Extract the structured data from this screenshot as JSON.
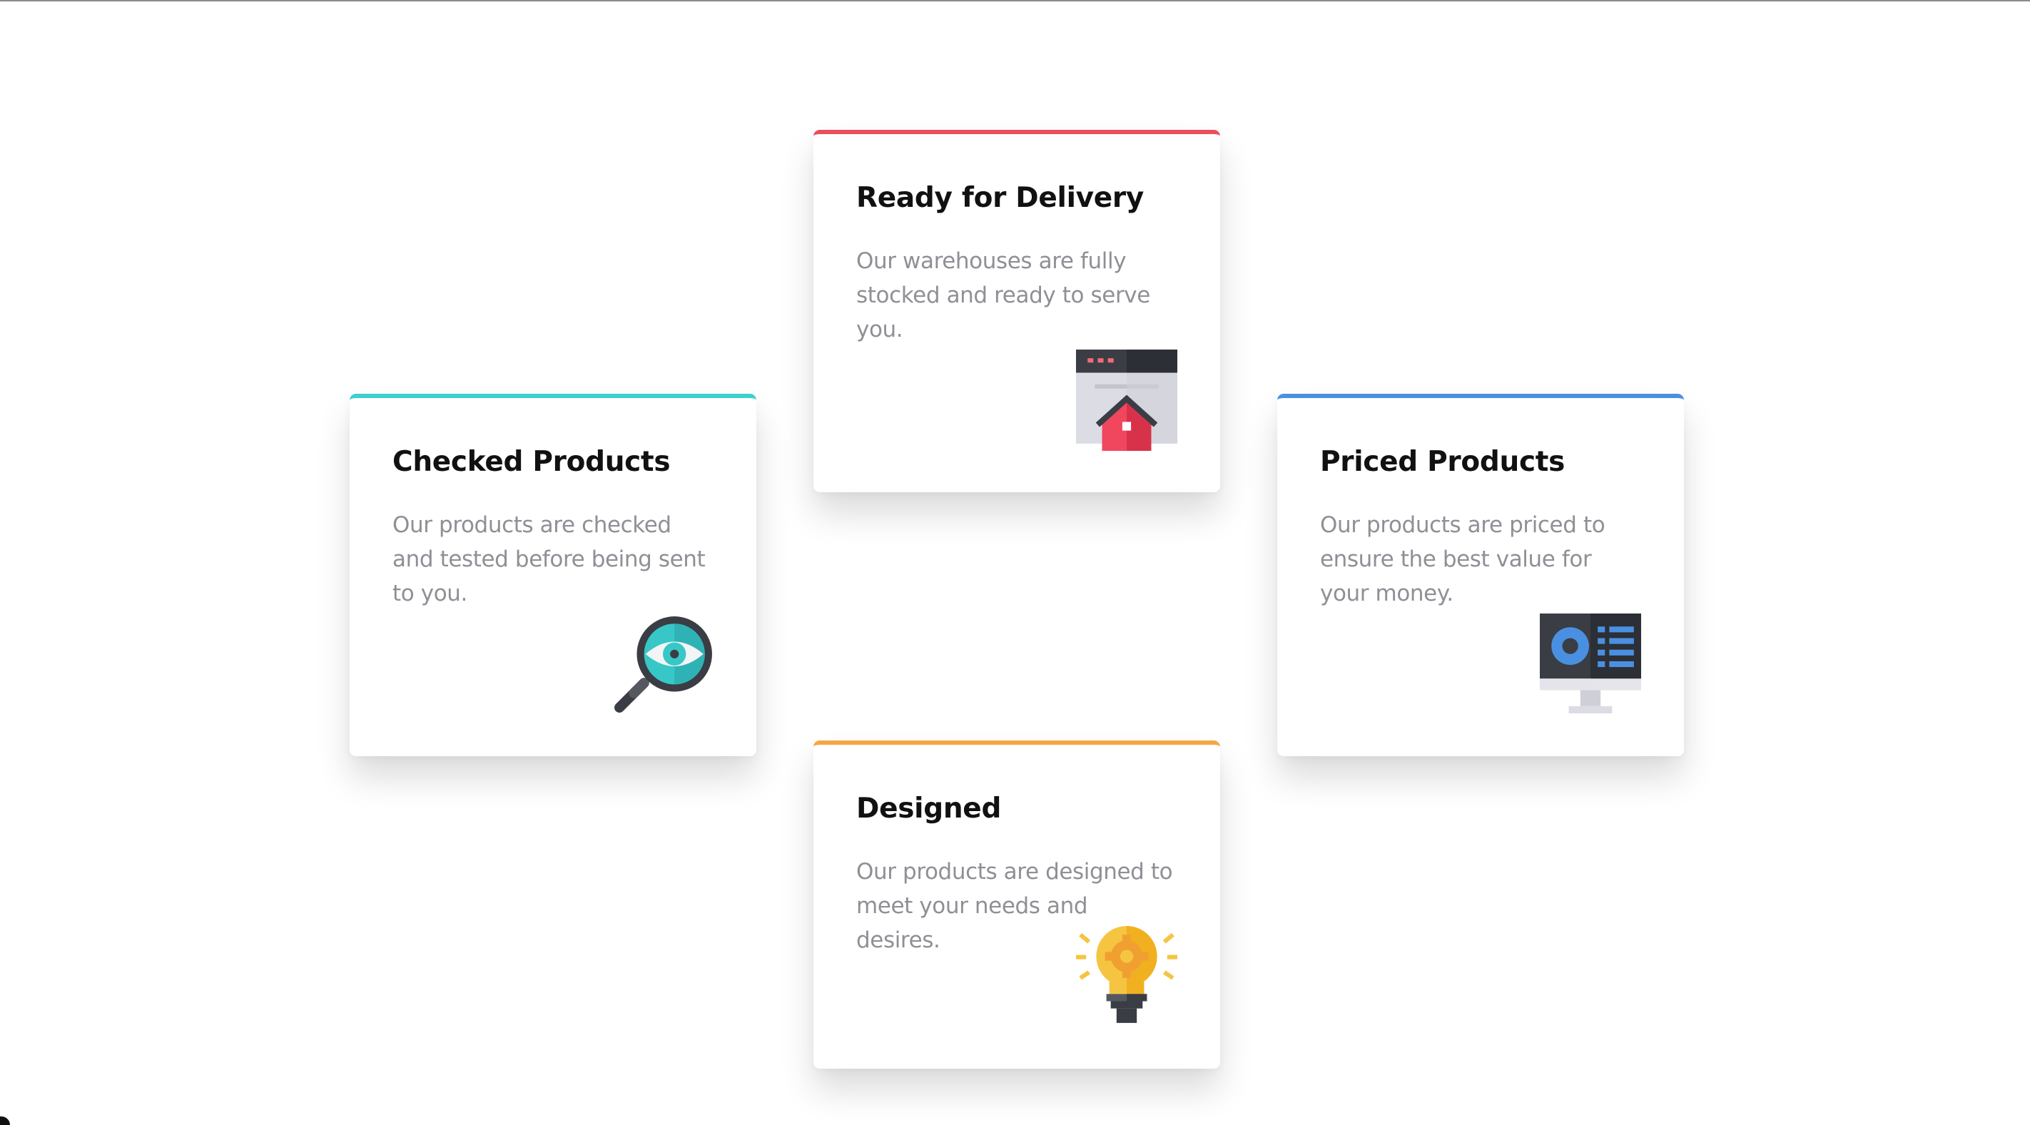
{
  "cards": [
    {
      "id": "delivery",
      "title": "Ready for Delivery",
      "description": "Our warehouses are fully stocked and ready to serve you.",
      "accent": "#e8505b",
      "icon": "warehouse-home-icon"
    },
    {
      "id": "checked",
      "title": "Checked Products",
      "description": "Our products are checked and tested before being sent to you.",
      "accent": "#3ecfcf",
      "icon": "magnifier-eye-icon"
    },
    {
      "id": "priced",
      "title": "Priced Products",
      "description": "Our products are priced to ensure the best value for your money.",
      "accent": "#4a90e2",
      "icon": "monitor-dashboard-icon"
    },
    {
      "id": "designed",
      "title": "Designed",
      "description": "Our products are designed to meet your needs and desires.",
      "accent": "#f5a742",
      "icon": "lightbulb-gear-icon"
    }
  ],
  "colors": {
    "title_text": "#111111",
    "body_text": "#8f8f96",
    "background": "#ffffff"
  }
}
